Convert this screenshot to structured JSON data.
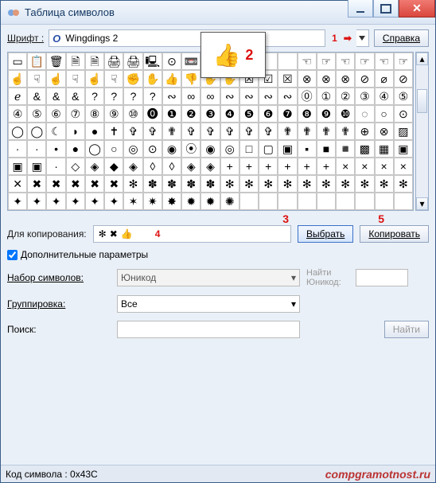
{
  "window": {
    "title": "Таблица символов"
  },
  "toolbar": {
    "font_label": "Шрифт :",
    "font_prefix": "O",
    "font_value": "Wingdings 2",
    "help_label": "Справка"
  },
  "annotations": {
    "n1": "1",
    "n2": "2",
    "n3": "3",
    "n4": "4",
    "n5": "5"
  },
  "popup": {
    "glyph": "👍"
  },
  "grid": {
    "cols": 21,
    "rows": [
      [
        "▭",
        "📋",
        "🗑",
        "🗎",
        "🗎",
        "🖨",
        "🖨",
        "🖳",
        "⊙",
        "📼",
        "👍",
        "",
        "",
        "",
        "",
        "☜",
        "☞",
        "☜",
        "☞",
        "☜",
        "☞"
      ],
      [
        "☝",
        "☟",
        "☝",
        "☟",
        "☝",
        "☟",
        "✊",
        "✋",
        "👍",
        "👎",
        "✋",
        "✋",
        "☒",
        "☑",
        "☒",
        "⊗",
        "⊗",
        "⊗",
        "⊘",
        "⌀",
        "⊘"
      ],
      [
        "ℯ",
        "&",
        "&",
        "&",
        "?",
        "?",
        "?",
        "?",
        "∾",
        "∞",
        "∞",
        "∾",
        "∾",
        "∾",
        "∾",
        "⓪",
        "①",
        "②",
        "③",
        "④",
        "⑤"
      ],
      [
        "④",
        "⑤",
        "⑥",
        "⑦",
        "⑧",
        "⑨",
        "⑩",
        "⓿",
        "❶",
        "❷",
        "❸",
        "❹",
        "❺",
        "❻",
        "❼",
        "❽",
        "❾",
        "❿",
        "◌",
        "○",
        "⊙"
      ],
      [
        "◯",
        "◯",
        "☾",
        "◗",
        "●",
        "✝",
        "✞",
        "✞",
        "✟",
        "✞",
        "✞",
        "✞",
        "✞",
        "✞",
        "✟",
        "✟",
        "✟",
        "✟",
        "⊕",
        "⊗",
        "▨"
      ],
      [
        "·",
        "·",
        "•",
        "●",
        "◯",
        "○",
        "◎",
        "⊙",
        "◉",
        "⦿",
        "◉",
        "◎",
        "□",
        "▢",
        "▣",
        "▪",
        "■",
        "◾",
        "▩",
        "▦",
        "▣"
      ],
      [
        "▣",
        "▣",
        "·",
        "◇",
        "◈",
        "◆",
        "◈",
        "◊",
        "◊",
        "◈",
        "◈",
        "+",
        "+",
        "+",
        "+",
        "+",
        "+",
        "×",
        "×",
        "×",
        "×"
      ],
      [
        "✕",
        "✖",
        "✖",
        "✖",
        "✖",
        "✖",
        "✻",
        "✽",
        "✽",
        "✽",
        "✽",
        "✻",
        "✻",
        "✻",
        "✻",
        "✻",
        "✻",
        "✻",
        "✻",
        "✻",
        "✻"
      ],
      [
        "✦",
        "✦",
        "✦",
        "✦",
        "✦",
        "✦",
        "✶",
        "✷",
        "✸",
        "✹",
        "✹",
        "✺",
        "",
        "",
        "",
        "",
        "",
        "",
        "",
        "",
        ""
      ]
    ]
  },
  "copy": {
    "label": "Для копирования:",
    "glyph1": "✻",
    "glyph2": "✖",
    "glyph3": "👍",
    "select_button": "Выбрать",
    "copy_button": "Копировать"
  },
  "advanced": {
    "checkbox_label": "Дополнительные параметры",
    "charset_label": "Набор символов:",
    "charset_value": "Юникод",
    "goto_label": "Найти Юникод:",
    "group_label": "Группировка:",
    "group_value": "Все",
    "search_label": "Поиск:",
    "search_button": "Найти"
  },
  "status": {
    "code": "Код символа : 0x43C",
    "watermark": "compgramotnost.ru"
  }
}
